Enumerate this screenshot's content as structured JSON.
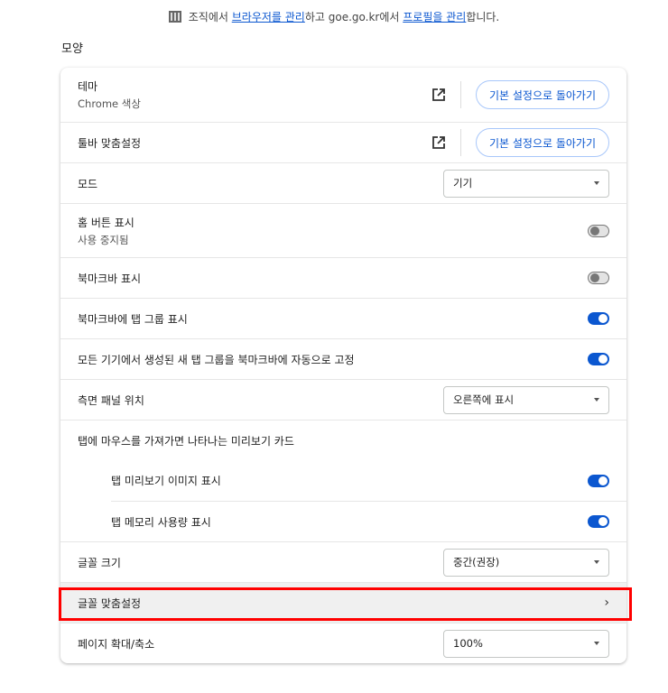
{
  "notice": {
    "t1": "조직에서 ",
    "link1": "브라우저를 관리",
    "t2": "하고 goe.go.kr에서 ",
    "link2": "프로필을 관리",
    "t3": "합니다."
  },
  "section_title": "모양",
  "theme": {
    "label": "테마",
    "sub": "Chrome 색상",
    "reset": "기본 설정으로 돌아가기"
  },
  "toolbar": {
    "label": "툴바 맞춤설정",
    "reset": "기본 설정으로 돌아가기"
  },
  "mode": {
    "label": "모드",
    "value": "기기"
  },
  "home": {
    "label": "홈 버튼 표시",
    "sub": "사용 중지됨",
    "on": false
  },
  "bookmarks_bar": {
    "label": "북마크바 표시",
    "on": false
  },
  "tab_groups": {
    "label": "북마크바에 탭 그룹 표시",
    "on": true
  },
  "auto_pin": {
    "label": "모든 기기에서 생성된 새 탭 그룹을 북마크바에 자동으로 고정",
    "on": true
  },
  "side_panel": {
    "label": "측면 패널 위치",
    "value": "오른쪽에 표시"
  },
  "hover_card": {
    "label": "탭에 마우스를 가져가면 나타나는 미리보기 카드"
  },
  "preview_image": {
    "label": "탭 미리보기 이미지 표시",
    "on": true
  },
  "memory": {
    "label": "탭 메모리 사용량 표시",
    "on": true
  },
  "font_size": {
    "label": "글꼴 크기",
    "value": "중간(권장)"
  },
  "font_custom": {
    "label": "글꼴 맞춤설정"
  },
  "zoom": {
    "label": "페이지 확대/축소",
    "value": "100%"
  }
}
